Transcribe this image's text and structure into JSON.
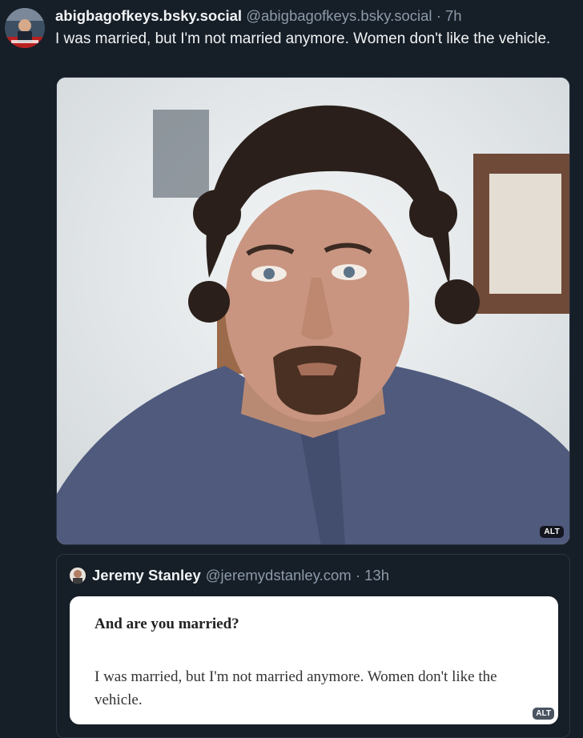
{
  "post": {
    "display_name": "abigbagofkeys.bsky.social",
    "handle": "@abigbagofkeys.bsky.social",
    "time": "· 7h",
    "text": "I was married, but I'm not married anymore. Women don't like the vehicle.",
    "media": {
      "alt_label": "ALT"
    }
  },
  "quote": {
    "display_name": "Jeremy Stanley",
    "handle": "@jeremydstanley.com",
    "time": "· 13h",
    "card": {
      "question": "And are you married?",
      "answer": "I was married, but I'm not married anymore. Women don't like the vehicle.",
      "alt_label": "ALT"
    }
  }
}
